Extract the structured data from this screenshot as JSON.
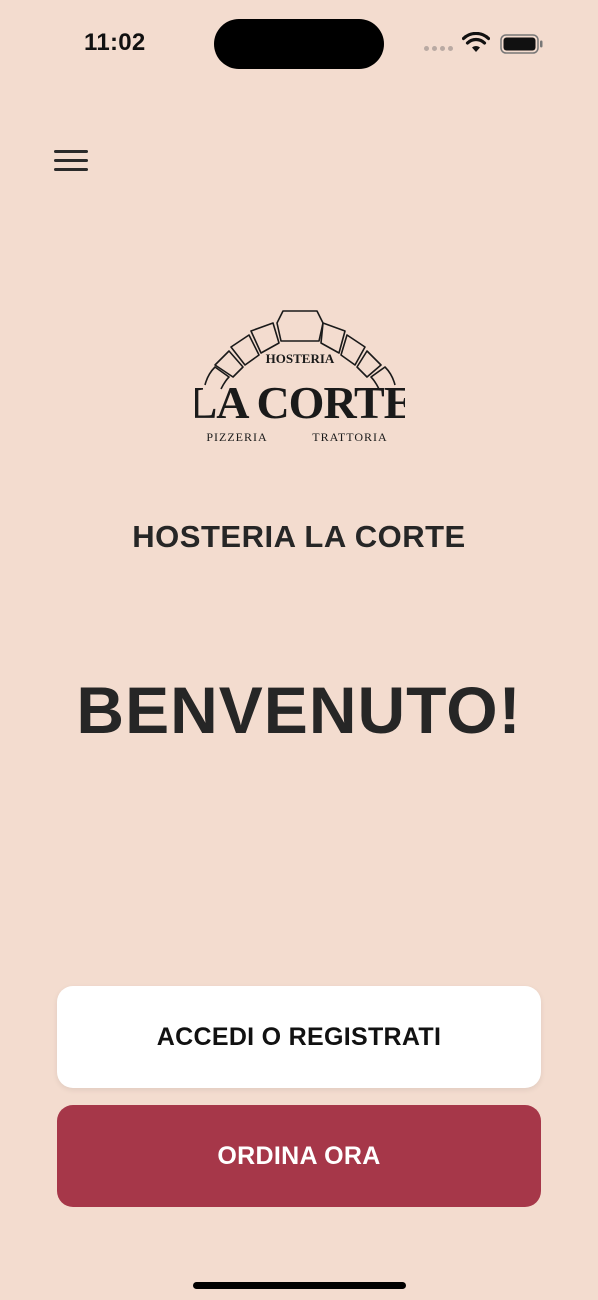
{
  "status_bar": {
    "time": "11:02"
  },
  "header": {
    "menu_icon": "hamburger-menu-icon"
  },
  "logo": {
    "top_text": "HOSTERIA",
    "main_text": "LA CORTE",
    "left_tag": "PIZZERIA",
    "right_tag": "TRATTORIA"
  },
  "main": {
    "restaurant_name": "HOSTERIA LA CORTE",
    "welcome": "BENVENUTO!"
  },
  "actions": {
    "login_label": "ACCEDI O REGISTRATI",
    "order_label": "ORDINA ORA"
  },
  "colors": {
    "background": "#f3dccf",
    "primary": "#a63749",
    "text": "#262626",
    "button_light": "#ffffff"
  }
}
